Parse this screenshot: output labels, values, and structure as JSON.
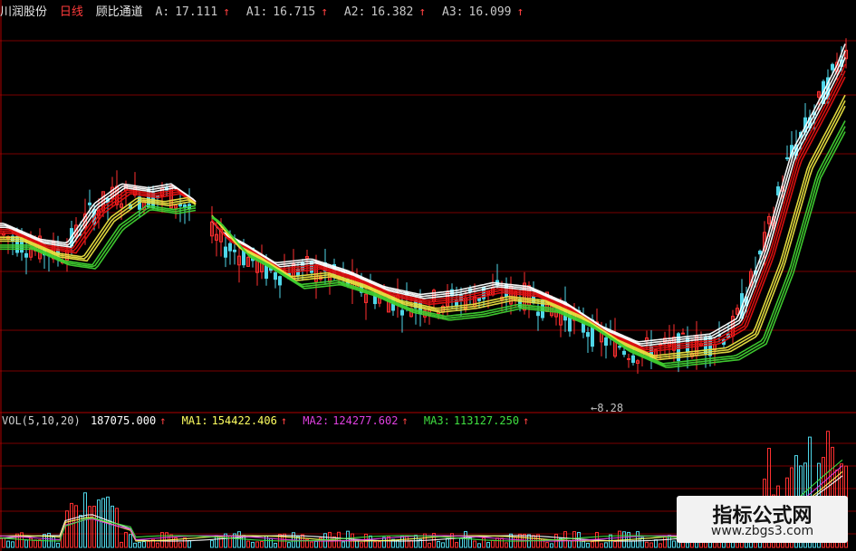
{
  "header": {
    "stock_name": "川润股份",
    "period": "日线",
    "indicator": "顾比通道",
    "lines": [
      {
        "label": "A:",
        "value": "17.111",
        "arrow": "↑"
      },
      {
        "label": "A1:",
        "value": "16.715",
        "arrow": "↑"
      },
      {
        "label": "A2:",
        "value": "16.382",
        "arrow": "↑"
      },
      {
        "label": "A3:",
        "value": "16.099",
        "arrow": "↑"
      }
    ]
  },
  "volume_header": {
    "label": "VOL(5,10,20)",
    "vol": "187075.000",
    "vol_arrow": "↑",
    "ma1_label": "MA1:",
    "ma1": "154422.406",
    "ma1_arrow": "↑",
    "ma2_label": "MA2:",
    "ma2": "124277.602",
    "ma2_arrow": "↑",
    "ma3_label": "MA3:",
    "ma3": "113127.250",
    "ma3_arrow": "↑"
  },
  "min_marker": "8.28",
  "watermark": {
    "title": "指标公式网",
    "url": "www.zbgs3.com"
  },
  "colors": {
    "background": "#000000",
    "grid": "#7a0000",
    "up": "#ff3030",
    "down": "#4fd6e8",
    "ma_white": "#ffffff",
    "ma_red": "#e01010",
    "ma_yellow": "#e8e040",
    "ma_green": "#40d030",
    "ma2_text": "#e040e0",
    "ma3_text": "#40e040",
    "ma1_text": "#ffff60"
  },
  "chart_data": {
    "type": "line",
    "price_range": [
      8.0,
      17.5
    ],
    "price_points": [
      [
        0,
        12.4
      ],
      [
        40,
        12.0
      ],
      [
        70,
        11.9
      ],
      [
        100,
        12.9
      ],
      [
        130,
        13.4
      ],
      [
        160,
        13.3
      ],
      [
        185,
        13.4
      ],
      [
        210,
        13.0
      ],
      [
        240,
        12.2
      ],
      [
        265,
        11.9
      ],
      [
        300,
        11.4
      ],
      [
        340,
        11.5
      ],
      [
        380,
        11.2
      ],
      [
        420,
        10.8
      ],
      [
        460,
        10.6
      ],
      [
        500,
        10.7
      ],
      [
        540,
        10.9
      ],
      [
        580,
        10.8
      ],
      [
        620,
        10.4
      ],
      [
        660,
        9.8
      ],
      [
        700,
        9.4
      ],
      [
        740,
        9.5
      ],
      [
        780,
        9.6
      ],
      [
        810,
        10.0
      ],
      [
        840,
        11.8
      ],
      [
        870,
        14.2
      ],
      [
        900,
        15.5
      ],
      [
        920,
        16.4
      ],
      [
        930,
        17.0
      ]
    ],
    "series": [
      {
        "name": "A",
        "color": "ma_white",
        "values": "price-derived"
      },
      {
        "name": "A1",
        "color": "ma_red",
        "values": "price-derived"
      },
      {
        "name": "A2",
        "color": "ma_yellow",
        "values": "price-derived"
      },
      {
        "name": "A3",
        "color": "ma_green",
        "values": "price-derived"
      }
    ]
  }
}
